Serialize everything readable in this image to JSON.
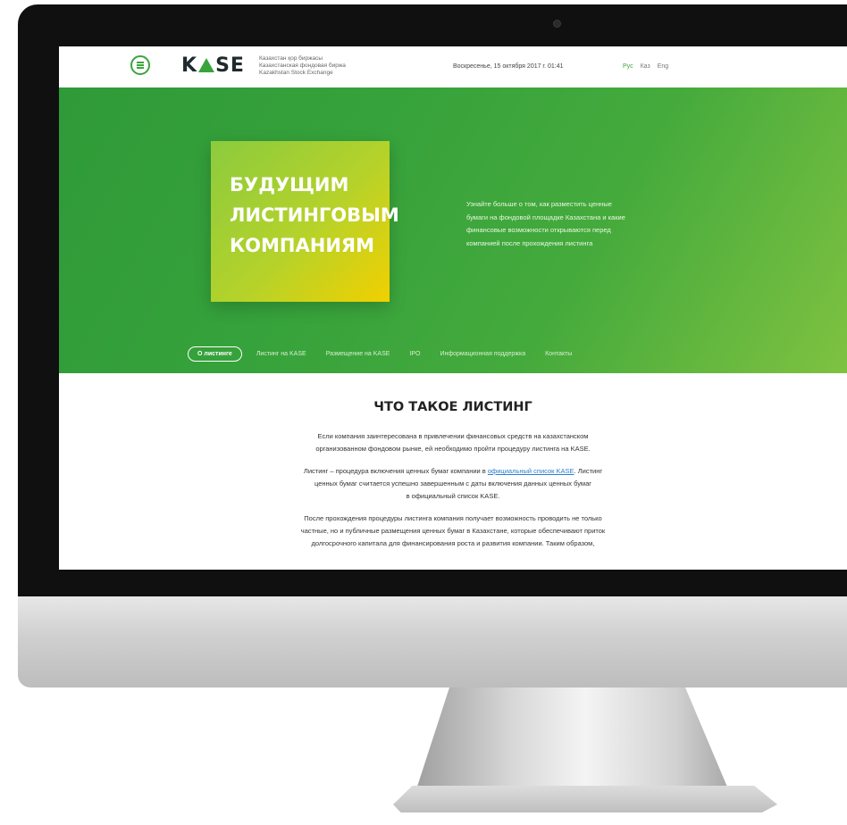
{
  "header": {
    "logo_text_left": "K",
    "logo_text_right": "SE",
    "logo_lines": [
      "Казахстан қор биржасы",
      "Казахстанская фондовая биржа",
      "Kazakhstan Stock Exchange"
    ],
    "date": "Воскресенье, 15 октября 2017 г. 01:41",
    "langs": [
      "Рус",
      "Каз",
      "Eng"
    ],
    "active_lang": "Рус"
  },
  "hero": {
    "title_lines": [
      "БУДУЩИМ",
      "ЛИСТИНГОВЫМ",
      "КОМПАНИЯМ"
    ],
    "text_lines": [
      "Узнайте больше о том, как разместить ценные",
      "бумаги на фондовой площадке Казахстана и какие",
      "финансовые возможности открываются перед",
      "компанией после прохождения листинга"
    ]
  },
  "subnav": {
    "items": [
      "О листинге",
      "Листинг на KASE",
      "Размещение на KASE",
      "IPO",
      "Информационная поддержка",
      "Контакты"
    ]
  },
  "content": {
    "heading": "ЧТО ТАКОЕ ЛИСТИНГ",
    "p1_lines": [
      "Если компания заинтересована в привлечении финансовых средств на казахстанском",
      "организованном фондовом рынке, ей необходимо пройти процедуру листинга на KASE."
    ],
    "p2_before_link": "Листинг – процедура включения ценных бумаг компании в ",
    "p2_link": "официальный список KASE",
    "p2_after_link": ". Листинг",
    "p2_lines": [
      "ценных бумаг считается успешно завершенным с даты включения данных ценных бумаг",
      "в официальный список KASE."
    ],
    "p3_lines": [
      "После прохождения процедуры листинга компания получает возможность проводить не только",
      "частные, но и публичные размещения ценных бумаг в Казахстане, которые обеспечивают приток",
      "долгосрочного капитала для финансирования роста и развития компании. Таким образом,"
    ]
  }
}
